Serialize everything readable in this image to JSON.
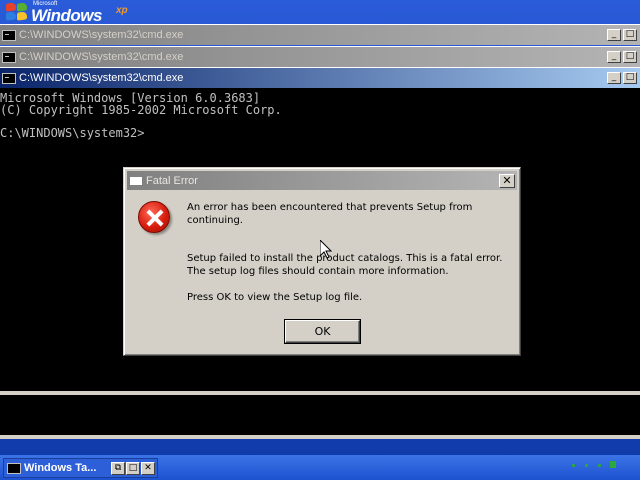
{
  "desktop": {
    "logo_microsoft": "Microsoft",
    "logo_windows": "Windows",
    "logo_version": "xp"
  },
  "cmd_windows": [
    {
      "title": "C:\\WINDOWS\\system32\\cmd.exe",
      "state": "inactive"
    },
    {
      "title": "C:\\WINDOWS\\system32\\cmd.exe",
      "state": "inactive"
    },
    {
      "title": "C:\\WINDOWS\\system32\\cmd.exe",
      "state": "active"
    }
  ],
  "window_buttons": {
    "minimize": "_",
    "maximize": "□"
  },
  "console": {
    "line1": "Microsoft Windows [Version 6.0.3683]",
    "line2": "(C) Copyright 1985-2002 Microsoft Corp.",
    "prompt": "C:\\WINDOWS\\system32>"
  },
  "dialog": {
    "title": "Fatal Error",
    "close": "✕",
    "icon": "error-icon",
    "message1": "An error has been encountered that prevents Setup from continuing.",
    "message2": "Setup failed to install the product catalogs. This is a fatal error. The setup log files should contain more information.",
    "message3": "Press OK to view the Setup log file.",
    "ok_label": "OK"
  },
  "taskbar": {
    "item_label": "Windows Ta...",
    "restore": "⧉",
    "maximize": "□",
    "close": "✕"
  },
  "colors": {
    "active_title_start": "#0a246a",
    "active_title_end": "#a6caf0",
    "inactive_title_start": "#808080",
    "dialog_face": "#d4d0c8",
    "desktop_blue": "#1d4bc2",
    "error_red": "#d81e0e"
  }
}
